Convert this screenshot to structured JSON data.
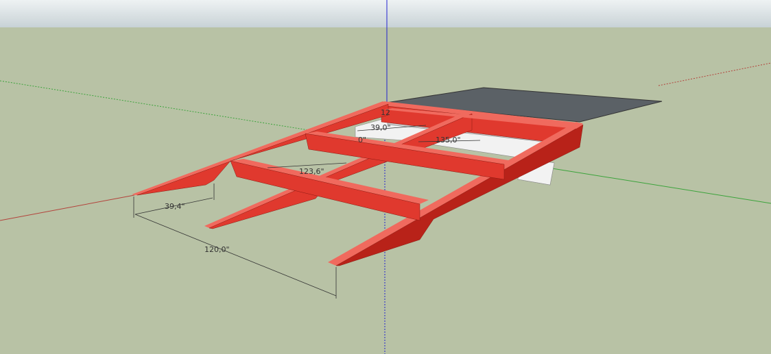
{
  "colors": {
    "sky_top": "#eef2f3",
    "sky_bottom": "#c8d2d6",
    "ground": "#b8c2a5",
    "beam_face": "#e0392e",
    "beam_top": "#f06a5e",
    "beam_dark": "#b82219",
    "platform": "#5b6166",
    "wall_light": "#f2f2f2",
    "wall_shade": "#c9c9c9",
    "axis_red": "#b3413a",
    "axis_green": "#3aa33a",
    "axis_blue": "#2020d0",
    "dim_line": "#333333"
  },
  "dimensions": {
    "overall_length": "120,0\"",
    "outer_spacing": "39,4\"",
    "diagonal": "123,6\"",
    "rear_width": "39,0\"",
    "rear_length": "135,0\"",
    "small_mark": "0\"",
    "tiny_mark": "12"
  }
}
